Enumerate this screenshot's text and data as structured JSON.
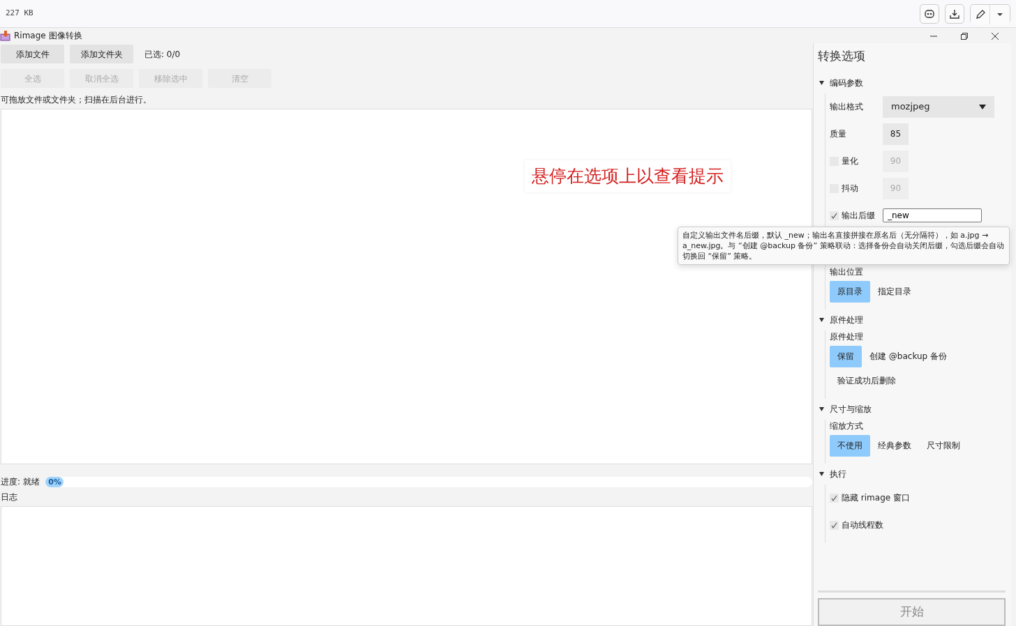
{
  "browser_bar": {
    "file_size": "227 KB"
  },
  "window": {
    "title": "Rimage 图像转换"
  },
  "toolbar_rows": [
    {
      "buttons": [
        {
          "label": "添加文件",
          "disabled": false
        },
        {
          "label": "添加文件夹",
          "disabled": false
        }
      ],
      "status": "已选: 0/0"
    },
    {
      "buttons": [
        {
          "label": "全选",
          "disabled": true
        },
        {
          "label": "取消全选",
          "disabled": true
        },
        {
          "label": "移除选中",
          "disabled": true
        },
        {
          "label": "清空",
          "disabled": true
        }
      ]
    }
  ],
  "drop_hint": "可拖放文件或文件夹；扫描在后台进行。",
  "hover_hint": "悬停在选项上以查看提示",
  "progress": {
    "label": "进度: 就绪",
    "level": 0,
    "reading": "0%"
  },
  "log_label": "日志",
  "options": {
    "title": "转换选项",
    "sections": [
      {
        "title": "编码参数",
        "expanded": true,
        "rows": [
          {
            "kind": "select",
            "label": "输出格式",
            "value": "mozjpeg"
          },
          {
            "kind": "number",
            "label": "质量",
            "value": "85"
          },
          {
            "kind": "check_number",
            "label": "量化",
            "checked": false,
            "value": "90"
          },
          {
            "kind": "check_number",
            "label": "抖动",
            "checked": false,
            "value": "90"
          },
          {
            "kind": "check_text",
            "label": "输出后缀",
            "checked": true,
            "value": "_new"
          },
          {
            "kind": "segmented",
            "label": "输出位置",
            "options": [
              {
                "label": "原目录",
                "selected": true
              },
              {
                "label": "指定目录",
                "selected": false
              }
            ]
          }
        ]
      },
      {
        "title": "原件处理",
        "expanded": true,
        "rows": [
          {
            "kind": "segmented",
            "label": "原件处理",
            "options": [
              {
                "label": "保留",
                "selected": true
              },
              {
                "label": "创建 @backup 备份",
                "selected": false
              },
              {
                "label": "验证成功后删除",
                "selected": false
              }
            ]
          }
        ]
      },
      {
        "title": "尺寸与缩放",
        "expanded": true,
        "rows": [
          {
            "kind": "segmented",
            "label": "缩放方式",
            "options": [
              {
                "label": "不使用",
                "selected": true
              },
              {
                "label": "经典参数",
                "selected": false
              },
              {
                "label": "尺寸限制",
                "selected": false
              }
            ]
          }
        ]
      },
      {
        "title": "执行",
        "expanded": true,
        "rows": [
          {
            "kind": "checkbox",
            "label": "隐藏 rimage 窗口",
            "checked": true
          },
          {
            "kind": "checkbox",
            "label": "自动线程数",
            "checked": true
          }
        ]
      }
    ]
  },
  "tooltip": {
    "text": "自定义输出文件名后缀，默认 _new；输出名直接拼接在原名后（无分隔符），如 a.jpg → a_new.jpg。与 “创建 @backup 备份” 策略联动：选择备份会自动关闭后缀，勾选后缀会自动切换回 “保留” 策略。"
  },
  "start_button": {
    "label": "开始"
  }
}
